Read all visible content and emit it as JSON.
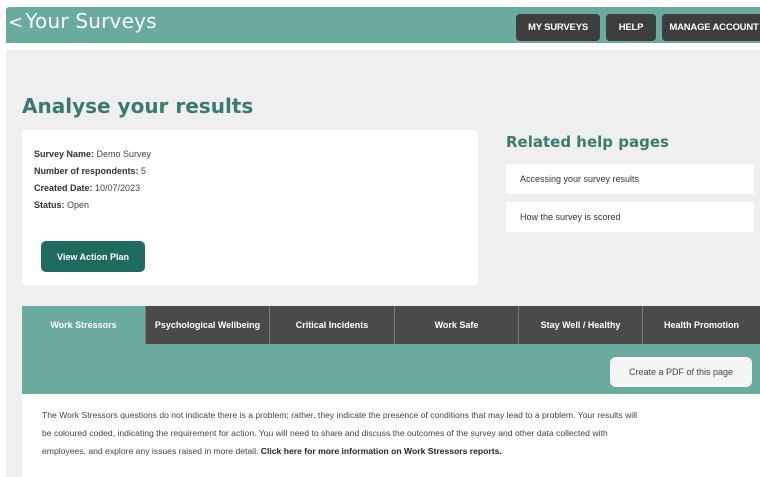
{
  "header": {
    "back_chevron": "<",
    "title": "Your Surveys",
    "nav": {
      "my_surveys": "MY SURVEYS",
      "help": "HELP",
      "manage_account": "MANAGE ACCOUNT"
    }
  },
  "page": {
    "title": "Analyse your results"
  },
  "survey_info": {
    "name_label": "Survey Name:",
    "name_value": " Demo Survey",
    "respondents_label": "Number of respondents:",
    "respondents_value": " 5",
    "created_label": "Created Date:",
    "created_value": " 10/07/2023",
    "status_label": "Status:",
    "status_value": " Open",
    "action_button": "View Action Plan"
  },
  "help": {
    "title": "Related help pages",
    "links": [
      "Accessing your survey results",
      "How the survey is scored"
    ]
  },
  "tabs": [
    {
      "label": "Work Stressors",
      "active": true
    },
    {
      "label": "Psychological Wellbeing",
      "active": false
    },
    {
      "label": "Critical Incidents",
      "active": false
    },
    {
      "label": "Work Safe",
      "active": false
    },
    {
      "label": "Stay Well / Healthy",
      "active": false
    },
    {
      "label": "Health Promotion",
      "active": false
    }
  ],
  "panel": {
    "pdf_button": "Create a PDF of this page",
    "description_line1": "The Work Stressors questions do not indicate there is a problem; rather, they indicate the presence of conditions that may lead to a problem.  Your results will",
    "description_line2": "be coloured coded, indicating the requirement for action. You will need to share and discuss the outcomes of the survey and other data collected with",
    "description_line3": "employees, and explore any issues raised in more detail.  ",
    "description_link": "Click here for more information on Work Stressors reports."
  },
  "colors": {
    "brand_teal": "#6aaa9f",
    "dark_teal": "#1e6b5f",
    "heading_teal": "#3b7a71",
    "tab_dark": "#4a4a4a"
  }
}
